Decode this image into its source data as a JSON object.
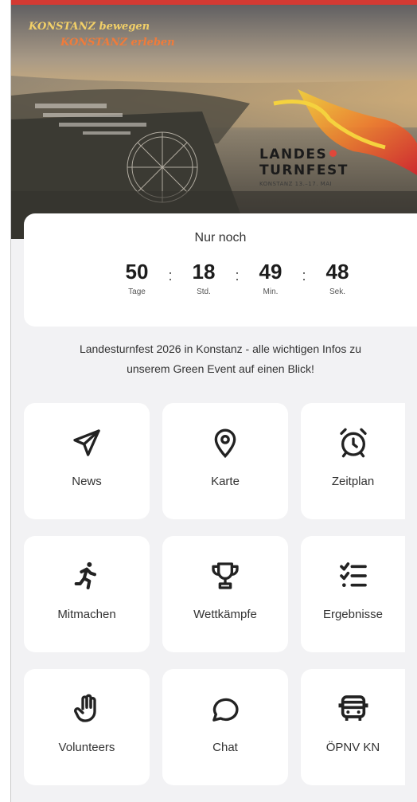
{
  "hero": {
    "slogan_line1": "KONSTANZ bewegen",
    "slogan_line2": "KONSTANZ erleben",
    "brand_line1": "LANDES",
    "brand_line2": "TURNFEST",
    "brand_sub": "KONSTANZ 13.–17. MAI"
  },
  "countdown": {
    "title": "Nur noch",
    "units": [
      {
        "value": "50",
        "label": "Tage"
      },
      {
        "value": "18",
        "label": "Std."
      },
      {
        "value": "49",
        "label": "Min."
      },
      {
        "value": "48",
        "label": "Sek."
      }
    ],
    "separator": ":"
  },
  "intro": {
    "line1": "Landesturnfest 2026 in Konstanz - alle wichtigen Infos zu",
    "line2": "unserem Green Event auf einen Blick!"
  },
  "tiles": [
    {
      "label": "News",
      "icon": "paper-plane-icon"
    },
    {
      "label": "Karte",
      "icon": "map-pin-icon"
    },
    {
      "label": "Zeitplan",
      "icon": "alarm-clock-icon"
    },
    {
      "label": "Mitmachen",
      "icon": "running-person-icon"
    },
    {
      "label": "Wettkämpfe",
      "icon": "trophy-icon"
    },
    {
      "label": "Ergebnisse",
      "icon": "checklist-icon"
    },
    {
      "label": "Volunteers",
      "icon": "hand-icon"
    },
    {
      "label": "Chat",
      "icon": "chat-bubble-icon"
    },
    {
      "label": "ÖPNV KN",
      "icon": "bus-icon"
    }
  ]
}
